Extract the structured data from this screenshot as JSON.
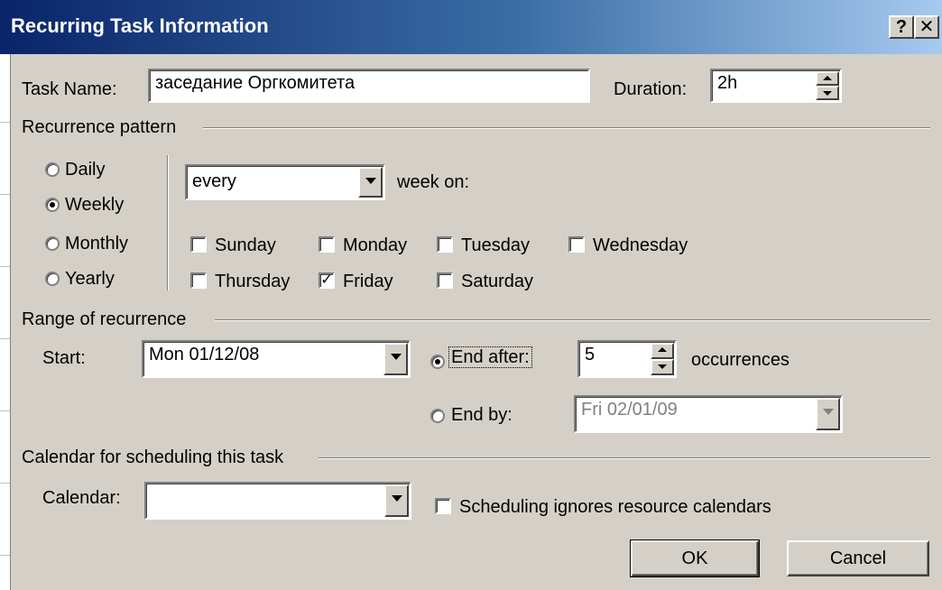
{
  "window": {
    "title": "Recurring Task Information",
    "help_glyph": "?",
    "close_glyph": "✕"
  },
  "task": {
    "name_label": "Task Name:",
    "name_value": "заседание Оргкомитета",
    "duration_label": "Duration:",
    "duration_value": "2h"
  },
  "pattern": {
    "heading": "Recurrence pattern",
    "options": [
      "Daily",
      "Weekly",
      "Monthly",
      "Yearly"
    ],
    "selected": "Weekly",
    "frequency_value": "every",
    "week_on_label": "week on:",
    "days": [
      {
        "label": "Sunday",
        "checked": false
      },
      {
        "label": "Monday",
        "checked": false
      },
      {
        "label": "Tuesday",
        "checked": false
      },
      {
        "label": "Wednesday",
        "checked": false
      },
      {
        "label": "Thursday",
        "checked": false
      },
      {
        "label": "Friday",
        "checked": true
      },
      {
        "label": "Saturday",
        "checked": false
      }
    ]
  },
  "range": {
    "heading": "Range of recurrence",
    "start_label": "Start:",
    "start_value": "Mon 01/12/08",
    "end_after_label": "End after:",
    "end_after_value": "5",
    "occurrences_label": "occurrences",
    "end_by_label": "End by:",
    "end_by_value": "Fri 02/01/09",
    "selected": "end_after"
  },
  "calendar": {
    "heading": "Calendar for scheduling this task",
    "calendar_label": "Calendar:",
    "calendar_value": "",
    "ignore_label": "Scheduling ignores resource calendars",
    "ignore_checked": false
  },
  "buttons": {
    "ok": "OK",
    "cancel": "Cancel"
  }
}
